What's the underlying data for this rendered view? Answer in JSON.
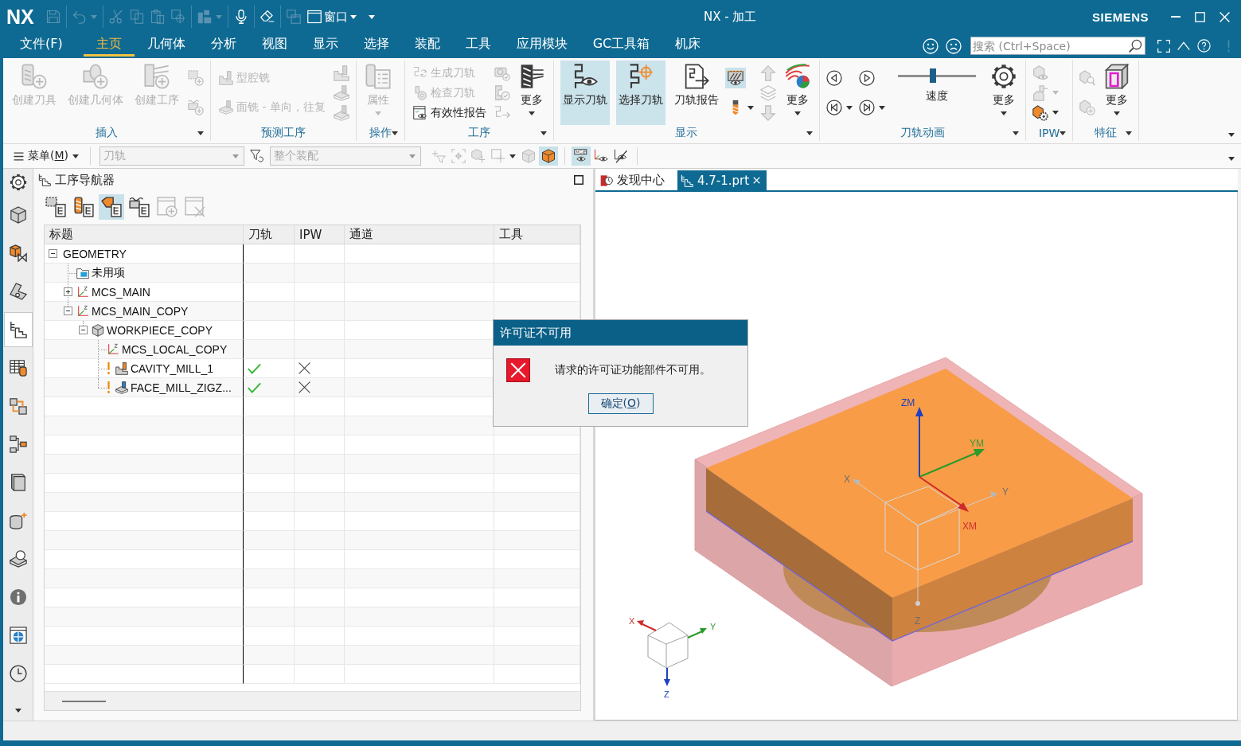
{
  "window": {
    "logo": "NX",
    "title": "NX - 加工",
    "brand": "SIEMENS",
    "quick_access": [
      [
        {
          "kind": "icon",
          "disabled": true
        }
      ],
      [
        {
          "kind": "split",
          "disabled": true
        }
      ],
      [
        {
          "kind": "icon",
          "disabled": true
        },
        {
          "kind": "icon",
          "disabled": true
        },
        {
          "kind": "icon",
          "disabled": true
        },
        {
          "kind": "icon",
          "disabled": true
        }
      ],
      [
        {
          "kind": "split",
          "disabled": true
        }
      ],
      [
        {
          "kind": "icon",
          "disabled": false
        }
      ],
      [
        {
          "kind": "icon",
          "disabled": false
        }
      ],
      [
        {
          "kind": "icon",
          "disabled": true
        },
        {
          "kind": "menu",
          "label": "窗口",
          "disabled": false
        }
      ]
    ]
  },
  "menu_tabs": [
    {
      "kind": "menu",
      "label": "文件(F)",
      "selected": false
    },
    {
      "kind": "tab",
      "label": "主页",
      "selected": true
    },
    {
      "kind": "tab",
      "label": "几何体",
      "selected": false
    },
    {
      "kind": "tab",
      "label": "分析",
      "selected": false
    },
    {
      "kind": "tab",
      "label": "视图",
      "selected": false
    },
    {
      "kind": "tab",
      "label": "显示",
      "selected": false
    },
    {
      "kind": "tab",
      "label": "选择",
      "selected": false
    },
    {
      "kind": "tab",
      "label": "装配",
      "selected": false
    },
    {
      "kind": "tab",
      "label": "工具",
      "selected": false
    },
    {
      "kind": "tab",
      "label": "应用模块",
      "selected": false
    },
    {
      "kind": "tab",
      "label": "GC工具箱",
      "selected": false
    },
    {
      "kind": "tab",
      "label": "机床",
      "selected": false
    }
  ],
  "search": {
    "placeholder": "搜索 (Ctrl+Space)"
  },
  "ribbon": {
    "groups": [
      {
        "label": "插入",
        "dropdown": true,
        "items": [
          {
            "kind": "large",
            "label": "创建刀具",
            "disabled": true,
            "menu": false
          },
          {
            "kind": "large",
            "label": "创建几何体",
            "disabled": true,
            "menu": false
          },
          {
            "kind": "large",
            "label": "创建工序",
            "disabled": true,
            "menu": false
          },
          {
            "kind": "stack",
            "items": [
              {
                "kind": "icon",
                "disabled": true
              },
              {
                "kind": "icon",
                "disabled": true
              }
            ]
          }
        ]
      },
      {
        "label": "预测工序",
        "dropdown": false,
        "items": [
          {
            "kind": "stack",
            "items": [
              {
                "kind": "small",
                "label": "型腔铣",
                "disabled": true
              },
              {
                "kind": "small",
                "label": "面铣 - 单向，往复",
                "disabled": true
              }
            ]
          },
          {
            "kind": "stack",
            "items": [
              {
                "kind": "icon",
                "disabled": true
              },
              {
                "kind": "icon",
                "disabled": true
              },
              {
                "kind": "icon",
                "disabled": true
              }
            ]
          }
        ]
      },
      {
        "label": "操作",
        "dropdown": true,
        "items": [
          {
            "kind": "large",
            "label": "属性",
            "disabled": true,
            "menu": true
          }
        ]
      },
      {
        "label": "工序",
        "dropdown": true,
        "items": [
          {
            "kind": "stack",
            "items": [
              {
                "kind": "small",
                "label": "生成刀轨",
                "disabled": true
              },
              {
                "kind": "small",
                "label": "检查刀轨",
                "disabled": true
              },
              {
                "kind": "small",
                "label": "有效性报告",
                "disabled": false
              }
            ]
          },
          {
            "kind": "stack",
            "items": [
              {
                "kind": "icon",
                "disabled": true
              },
              {
                "kind": "icon",
                "disabled": true
              },
              {
                "kind": "icon",
                "disabled": true
              }
            ]
          },
          {
            "kind": "large",
            "label": "更多",
            "disabled": false,
            "menu": true
          }
        ]
      },
      {
        "label": "显示",
        "dropdown": true,
        "items": [
          {
            "kind": "large",
            "label": "显示刀轨",
            "disabled": false,
            "menu": false,
            "on": true
          },
          {
            "kind": "large",
            "label": "选择刀轨",
            "disabled": false,
            "menu": false,
            "on": true
          },
          {
            "kind": "large",
            "label": "刀轨报告",
            "disabled": false,
            "menu": false,
            "on": false
          },
          {
            "kind": "stack",
            "items": [
              {
                "kind": "icon",
                "disabled": false,
                "on": true
              },
              {
                "kind": "split",
                "disabled": false,
                "on": false
              }
            ]
          },
          {
            "kind": "stack",
            "items": [
              {
                "kind": "icon",
                "disabled": true,
                "on": false
              },
              {
                "kind": "icon",
                "disabled": true,
                "on": false
              },
              {
                "kind": "icon",
                "disabled": true,
                "on": false
              }
            ]
          },
          {
            "kind": "large",
            "label": "更多",
            "disabled": false,
            "menu": true,
            "on": false
          }
        ]
      },
      {
        "label": "刀轨动画",
        "dropdown": true,
        "items": [
          {
            "kind": "stack",
            "items": [
              {
                "kind": "icon",
                "disabled": false
              },
              {
                "kind": "split",
                "disabled": false
              }
            ]
          },
          {
            "kind": "stack",
            "items": [
              {
                "kind": "icon",
                "disabled": false
              },
              {
                "kind": "split",
                "disabled": false
              }
            ]
          },
          {
            "kind": "slider",
            "label": "速度",
            "level": 0.45
          },
          {
            "kind": "large",
            "label": "更多",
            "disabled": false,
            "menu": true
          }
        ]
      },
      {
        "label": "IPW",
        "dropdown": true,
        "items": [
          {
            "kind": "stack",
            "items": [
              {
                "kind": "icon",
                "disabled": true
              },
              {
                "kind": "split",
                "disabled": true
              },
              {
                "kind": "split",
                "disabled": false
              }
            ]
          }
        ]
      },
      {
        "label": "特征",
        "dropdown": true,
        "items": [
          {
            "kind": "stack",
            "items": [
              {
                "kind": "icon",
                "disabled": true
              },
              {
                "kind": "icon",
                "disabled": true
              }
            ]
          },
          {
            "kind": "large",
            "label": "更多",
            "disabled": false,
            "menu": true
          }
        ]
      }
    ]
  },
  "selection_bar": {
    "menu": {
      "before": "菜单(",
      "mnemonic": "M",
      "after": ")"
    },
    "type_filter": {
      "value": "刀轨",
      "disabled": true
    },
    "scope": {
      "value": "整个装配",
      "disabled": true
    },
    "tools": [
      [
        {
          "kind": "icon",
          "disabled": true,
          "on": false
        },
        {
          "kind": "icon",
          "disabled": true,
          "on": false
        },
        {
          "kind": "icon",
          "disabled": true,
          "on": false
        },
        {
          "kind": "split",
          "disabled": true,
          "on": false
        },
        {
          "kind": "icon",
          "disabled": true,
          "on": false
        },
        {
          "kind": "icon",
          "disabled": false,
          "on": true
        }
      ],
      [
        {
          "kind": "icon",
          "disabled": false,
          "on": true
        },
        {
          "kind": "icon",
          "disabled": false,
          "on": false
        },
        {
          "kind": "icon",
          "disabled": false,
          "on": false
        }
      ]
    ]
  },
  "resource_bar": [
    {
      "selected": false
    },
    {
      "selected": false
    },
    {
      "selected": false
    },
    {
      "selected": false
    },
    {
      "selected": true
    },
    {
      "selected": false
    },
    {
      "selected": false
    },
    {
      "selected": false
    },
    {
      "selected": false
    },
    {
      "selected": false
    },
    {
      "selected": false
    },
    {
      "selected": false
    },
    {
      "selected": false
    },
    {
      "selected": false
    }
  ],
  "navigator": {
    "title": "工序导航器",
    "toolbar": [
      {
        "selected": false,
        "disabled": false
      },
      {
        "selected": false,
        "disabled": false
      },
      {
        "selected": true,
        "disabled": false
      },
      {
        "selected": false,
        "disabled": false
      },
      {
        "selected": false,
        "disabled": true
      },
      {
        "selected": false,
        "disabled": true
      }
    ],
    "columns": [
      "标题",
      "刀轨",
      "IPW",
      "通道",
      "工具"
    ],
    "tree": [
      {
        "label": "GEOMETRY",
        "kind": "root",
        "expanded": true,
        "children": [
          {
            "label": "未用项",
            "kind": "folder"
          },
          {
            "label": "MCS_MAIN",
            "kind": "mcs",
            "expanded": false
          },
          {
            "label": "MCS_MAIN_COPY",
            "kind": "mcs",
            "expanded": true,
            "children": [
              {
                "label": "WORKPIECE_COPY",
                "kind": "workpiece",
                "expanded": true,
                "children": [
                  {
                    "label": "MCS_LOCAL_COPY",
                    "kind": "mcs"
                  },
                  {
                    "label": "CAVITY_MILL_1",
                    "kind": "cavity",
                    "warning": true,
                    "toolpath_generated": true,
                    "ipw_generated": false
                  },
                  {
                    "label": "FACE_MILL_ZIGZ...",
                    "kind": "facemill",
                    "warning": true,
                    "toolpath_generated": true,
                    "ipw_generated": false
                  }
                ]
              }
            ]
          }
        ]
      }
    ]
  },
  "viewport": {
    "tabs": [
      {
        "kind": "home",
        "label": "发现中心",
        "selected": false,
        "closable": false
      },
      {
        "kind": "part",
        "label": "4.7-1.prt",
        "selected": true,
        "closable": true
      }
    ],
    "model_axes": [
      "ZM",
      "YM",
      "XM"
    ],
    "work_axes": [
      "X",
      "Y",
      "Z"
    ],
    "triad_axes": [
      "X",
      "Y",
      "Z"
    ]
  },
  "dialog": {
    "title": "许可证不可用",
    "kind": "error",
    "message": "请求的许可证功能部件不可用。",
    "button": {
      "before": "确定(",
      "mnemonic": "O",
      "after": ")"
    }
  }
}
